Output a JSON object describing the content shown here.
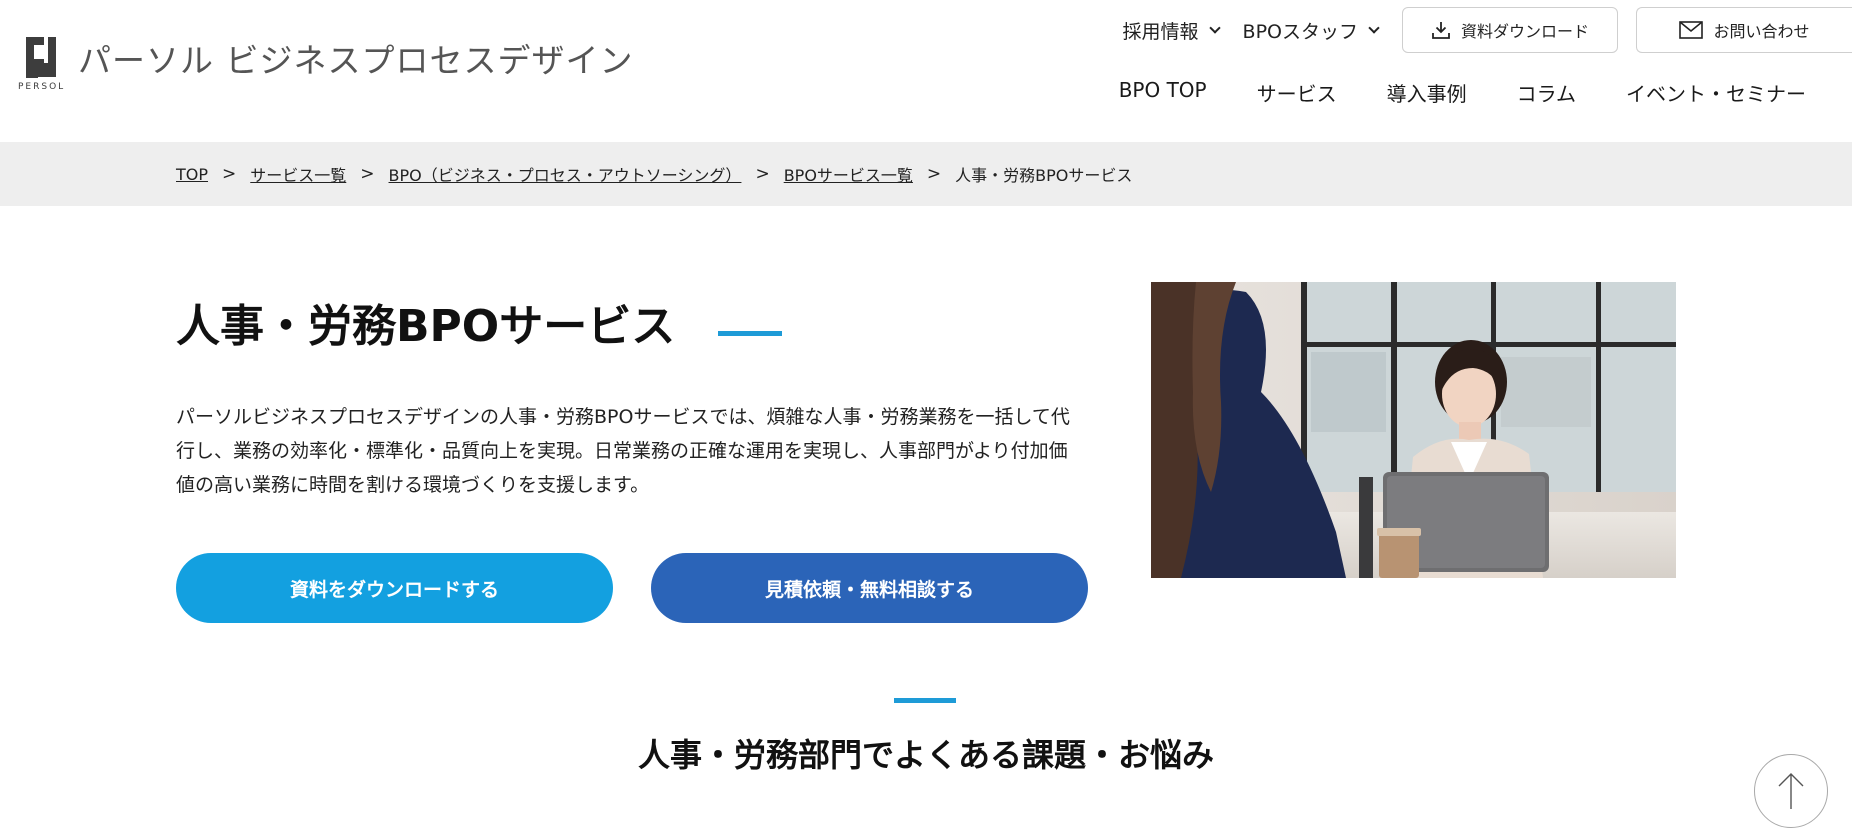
{
  "logo": {
    "name": "パーソル ビジネスプロセスデザイン",
    "sub": "PERSOL"
  },
  "header": {
    "util_menus": [
      "採用情報",
      "BPOスタッフ"
    ],
    "download_label": "資料ダウンロード",
    "contact_label": "お問い合わせ",
    "nav": [
      "BPO TOP",
      "サービス",
      "導入事例",
      "コラム",
      "イベント・セミナー"
    ]
  },
  "breadcrumb": {
    "items": [
      "TOP",
      "サービス一覧",
      "BPO（ビジネス・プロセス・アウトソーシング）",
      "BPOサービス一覧"
    ],
    "separator": ">",
    "current": "人事・労務BPOサービス"
  },
  "hero": {
    "title": "人事・労務BPOサービス",
    "description": "パーソルビジネスプロセスデザインの人事・労務BPOサービスでは、煩雑な人事・労務業務を一括して代行し、業務の効率化・標準化・品質向上を実現。日常業務の正確な運用を実現し、人事部門がより付加価値の高い業務に時間を割ける環境づくりを支援します。",
    "cta_primary": "資料をダウンロードする",
    "cta_secondary": "見積依頼・無料相談する"
  },
  "section": {
    "title": "人事・労務部門でよくある課題・お悩み"
  },
  "colors": {
    "accent": "#1e9bd7",
    "cta_primary": "#13a0e0",
    "cta_secondary": "#2b64b8",
    "breadcrumb_bg": "#eeeeee"
  },
  "icons": {
    "download": "download-icon",
    "contact": "mail-icon",
    "back_to_top": "arrow-up-icon"
  }
}
